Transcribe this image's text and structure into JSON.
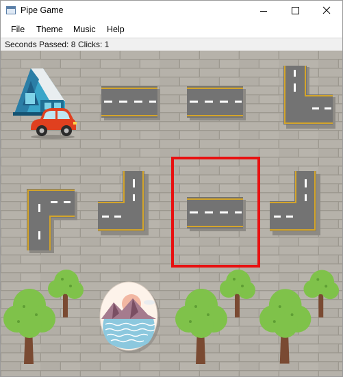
{
  "window": {
    "title": "Pipe Game"
  },
  "menu": {
    "items": [
      "File",
      "Theme",
      "Music",
      "Help"
    ]
  },
  "status": {
    "seconds_label": "Seconds Passed: 8",
    "clicks_label": "Clicks: 1"
  },
  "board": {
    "background": "brick-wall",
    "tiles": [
      {
        "name": "tile-start-house-car",
        "kind": "start"
      },
      {
        "name": "tile-road-horizontal",
        "kind": "road-straight",
        "orientation": "horizontal"
      },
      {
        "name": "tile-road-horizontal",
        "kind": "road-straight",
        "orientation": "horizontal"
      },
      {
        "name": "tile-road-corner",
        "kind": "road-corner",
        "connects": [
          "up",
          "right"
        ]
      },
      {
        "name": "tile-road-corner",
        "kind": "road-corner",
        "connects": [
          "down",
          "right"
        ]
      },
      {
        "name": "tile-road-corner",
        "kind": "road-corner",
        "connects": [
          "up",
          "left"
        ]
      },
      {
        "name": "tile-road-horizontal",
        "kind": "road-straight",
        "orientation": "horizontal",
        "selected": true
      },
      {
        "name": "tile-road-corner",
        "kind": "road-corner",
        "connects": [
          "up",
          "left"
        ]
      },
      {
        "name": "tile-trees",
        "kind": "scenery"
      },
      {
        "name": "tile-goal-lake",
        "kind": "goal"
      },
      {
        "name": "tile-trees",
        "kind": "scenery"
      },
      {
        "name": "tile-trees",
        "kind": "scenery"
      }
    ],
    "selection_color": "#e81010",
    "road_color": "#707070",
    "road_edge_color": "#d4a52a",
    "road_marking_color": "#ffffff"
  }
}
